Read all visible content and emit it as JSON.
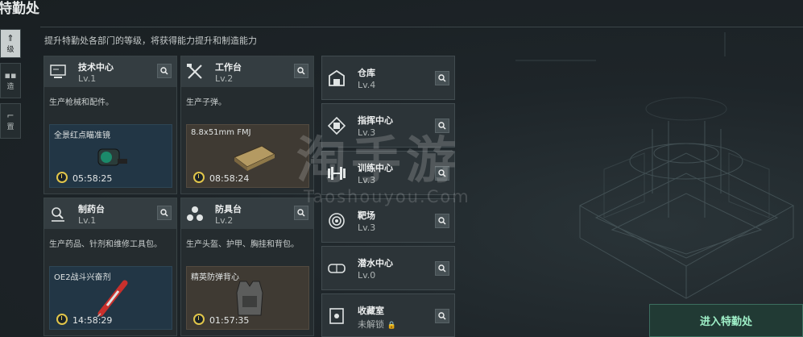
{
  "header": {
    "title": "特勤处",
    "subtitle": "提升特勤处各部门的等级，将获得能力提升和制造能力"
  },
  "sidenav": {
    "items": [
      {
        "glyph": "⇑",
        "label": "级"
      },
      {
        "glyph": "",
        "label": "造"
      },
      {
        "glyph": "",
        "label": "置"
      }
    ]
  },
  "workshops": [
    {
      "name": "技术中心",
      "level": "Lv.1",
      "icon": "computer-icon",
      "desc": "生产枪械和配件。",
      "product": "全景红点瞄准镜",
      "time": "05:58:25",
      "art": "scope"
    },
    {
      "name": "工作台",
      "level": "Lv.2",
      "icon": "tools-icon",
      "desc": "生产子弹。",
      "product": "8.8x51mm FMJ",
      "time": "08:58:24",
      "art": "ammo"
    },
    {
      "name": "制药台",
      "level": "Lv.1",
      "icon": "microscope-icon",
      "desc": "生产药品、针剂和维修工具包。",
      "product": "OE2战斗兴奋剂",
      "time": "14:58:29",
      "art": "syringe"
    },
    {
      "name": "防具台",
      "level": "Lv.2",
      "icon": "armor-parts-icon",
      "desc": "生产头盔、护甲、胸挂和背包。",
      "product": "精英防弹背心",
      "time": "01:57:35",
      "art": "vest"
    }
  ],
  "rooms": [
    {
      "name": "仓库",
      "level": "Lv.4",
      "icon": "warehouse-icon"
    },
    {
      "name": "指挥中心",
      "level": "Lv.3",
      "icon": "command-chip-icon"
    },
    {
      "name": "训练中心",
      "level": "Lv.3",
      "icon": "dumbbell-icon"
    },
    {
      "name": "靶场",
      "level": "Lv.3",
      "icon": "target-icon"
    },
    {
      "name": "潜水中心",
      "level": "Lv.0",
      "icon": "diving-mask-icon"
    },
    {
      "name": "收藏室",
      "level": "未解锁",
      "icon": "safe-icon",
      "locked": true
    }
  ],
  "enter_button": "进入特勤处",
  "watermark": {
    "main": "淘手游",
    "sub": "Taoshouyou.Com"
  },
  "colors": {
    "accent_green": "#9ff0c8",
    "timer_yellow": "#e2c64a",
    "panel": "#252c2f"
  }
}
